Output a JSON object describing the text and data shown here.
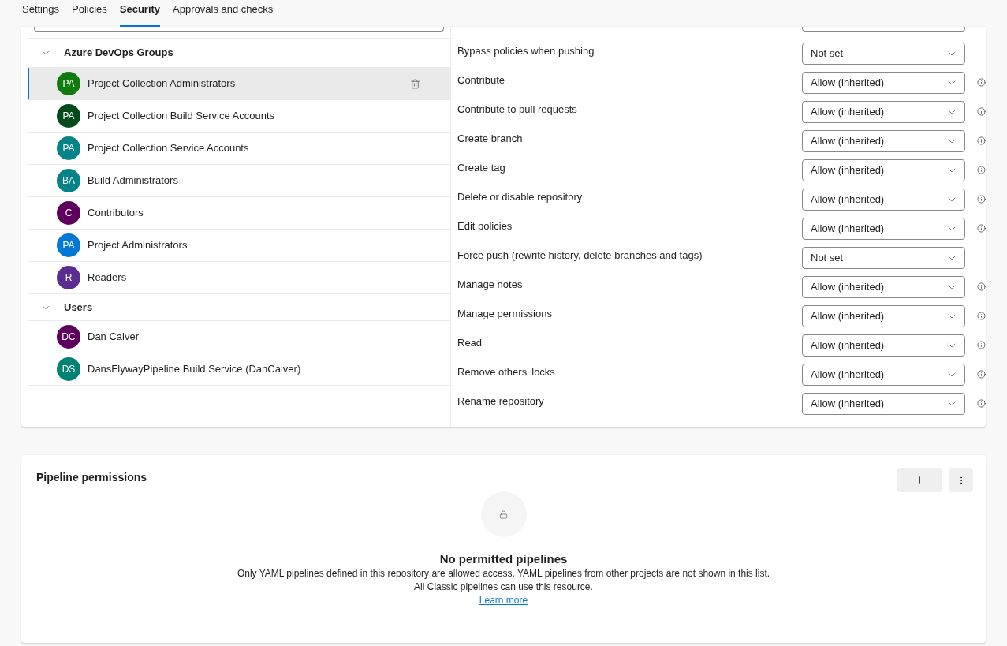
{
  "tabs": [
    {
      "label": "Settings",
      "selected": false
    },
    {
      "label": "Policies",
      "selected": false
    },
    {
      "label": "Security",
      "selected": true
    },
    {
      "label": "Approvals and checks",
      "selected": false
    }
  ],
  "groups": [
    {
      "title": "Azure DevOps Groups",
      "expanded": true,
      "children": [
        {
          "initials": "PA",
          "name": "Project Collection Administrators",
          "color": "#107c10",
          "selected": true
        },
        {
          "initials": "PA",
          "name": "Project Collection Build Service Accounts",
          "color": "#004b1c",
          "selected": false
        },
        {
          "initials": "PA",
          "name": "Project Collection Service Accounts",
          "color": "#038387",
          "selected": false
        },
        {
          "initials": "BA",
          "name": "Build Administrators",
          "color": "#038387",
          "selected": false
        },
        {
          "initials": "C",
          "name": "Contributors",
          "color": "#5c005c",
          "selected": false
        },
        {
          "initials": "PA",
          "name": "Project Administrators",
          "color": "#0078d4",
          "selected": false
        },
        {
          "initials": "R",
          "name": "Readers",
          "color": "#5c2d91",
          "selected": false
        }
      ]
    },
    {
      "title": "Users",
      "expanded": true,
      "children": [
        {
          "initials": "DC",
          "name": "Dan Calver",
          "color": "#5c005c",
          "selected": false
        },
        {
          "initials": "DS",
          "name": "DansFlywayPipeline Build Service (DanCalver)",
          "color": "#008272",
          "selected": false
        }
      ]
    }
  ],
  "permissions": [
    {
      "label": "Bypass policies when pushing",
      "value": "Not set",
      "info": false
    },
    {
      "label": "Contribute",
      "value": "Allow (inherited)",
      "info": true
    },
    {
      "label": "Contribute to pull requests",
      "value": "Allow (inherited)",
      "info": true
    },
    {
      "label": "Create branch",
      "value": "Allow (inherited)",
      "info": true
    },
    {
      "label": "Create tag",
      "value": "Allow (inherited)",
      "info": true
    },
    {
      "label": "Delete or disable repository",
      "value": "Allow (inherited)",
      "info": true
    },
    {
      "label": "Edit policies",
      "value": "Allow (inherited)",
      "info": true
    },
    {
      "label": "Force push (rewrite history, delete branches and tags)",
      "value": "Not set",
      "info": false
    },
    {
      "label": "Manage notes",
      "value": "Allow (inherited)",
      "info": true
    },
    {
      "label": "Manage permissions",
      "value": "Allow (inherited)",
      "info": true
    },
    {
      "label": "Read",
      "value": "Allow (inherited)",
      "info": true
    },
    {
      "label": "Remove others' locks",
      "value": "Allow (inherited)",
      "info": true
    },
    {
      "label": "Rename repository",
      "value": "Allow (inherited)",
      "info": true
    }
  ],
  "pipeline_permissions": {
    "title": "Pipeline permissions",
    "empty_title": "No permitted pipelines",
    "lines": [
      "Only YAML pipelines defined in this repository are allowed access. YAML pipelines from other projects are not shown in this list.",
      "All Classic pipelines can use this resource."
    ],
    "link": "Learn more"
  }
}
